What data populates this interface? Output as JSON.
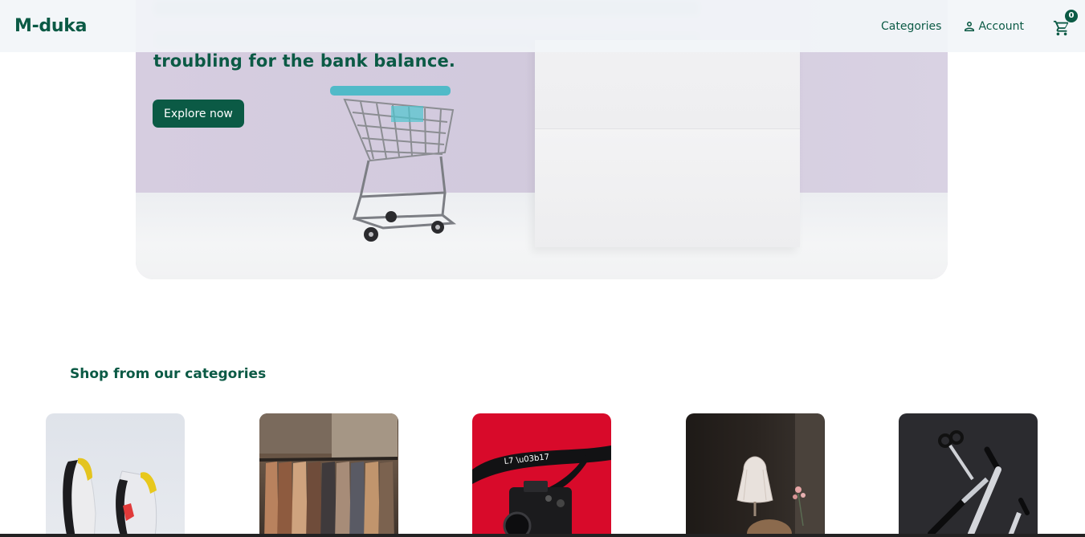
{
  "header": {
    "brand": "M-duka",
    "nav": {
      "categories_label": "Categories",
      "account_label": "Account"
    },
    "cart_count": "0",
    "icons": {
      "account": "person-icon",
      "cart": "shopping-cart-icon"
    }
  },
  "hero": {
    "headline": "troubling for the bank balance.",
    "cta_label": "Explore now"
  },
  "categories": {
    "title": "Shop from our categories",
    "items": [
      {
        "image": "sneakers"
      },
      {
        "image": "clothing-rack"
      },
      {
        "image": "camera"
      },
      {
        "image": "lamp"
      },
      {
        "image": "knives"
      }
    ]
  },
  "colors": {
    "brand_green": "#0b5a45",
    "navbar_bg": "#f2f5f9",
    "hero_wall": "#d6cde0"
  }
}
